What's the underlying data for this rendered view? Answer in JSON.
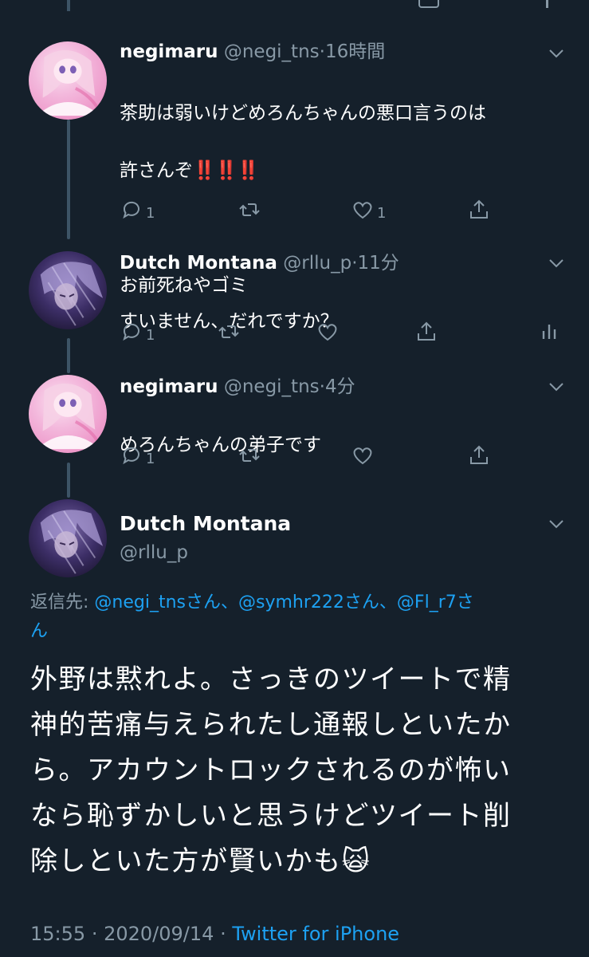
{
  "tweets": [
    {
      "display_name": "negimaru",
      "handle": "@negi_tns",
      "separator": "·",
      "time": "16時間",
      "text_line1": "茶助は弱いけどめろんちゃんの悪口言うのは",
      "text_line2_prefix": "許さんぞ",
      "text_line2_emoji": "‼️‼️‼️",
      "text_line3": "お前死ねやゴミ",
      "reply_count": "1",
      "like_count": "1",
      "avatar_icon": "anime-pink-avatar"
    },
    {
      "display_name": "Dutch Montana",
      "handle": "@rllu_p",
      "separator": "·",
      "time": "11分",
      "text": "すいません、だれですか？",
      "reply_count": "1",
      "avatar_icon": "anime-purple-avatar"
    },
    {
      "display_name": "negimaru",
      "handle": "@negi_tns",
      "separator": "·",
      "time": "4分",
      "text": "めろんちゃんの弟子です",
      "reply_count": "1",
      "avatar_icon": "anime-pink-avatar"
    }
  ],
  "focus": {
    "display_name": "Dutch Montana",
    "handle": "@rllu_p",
    "reply_label": "返信先:",
    "mention1": "@negi_tnsさん、",
    "mention2": "@symhr222さん、",
    "mention3": "@Fl_r7さ",
    "mention3b": "ん",
    "text_line1": "外野は黙れよ。さっきのツイートで精",
    "text_line2": "神的苦痛与えられたし通報しといたか",
    "text_line3": "ら。アカウントロックされるのが怖い",
    "text_line4": "なら恥ずかしいと思うけどツイート削",
    "text_line5": "除しといた方が賢いかも",
    "text_emoji": "🙀",
    "time": "15:55",
    "separator": "·",
    "date": "2020/09/14",
    "source": "Twitter for iPhone"
  },
  "colors": {
    "background": "#15202b",
    "secondary_text": "#8899a6",
    "link": "#1da1f2",
    "thread_line": "#3d5466"
  }
}
